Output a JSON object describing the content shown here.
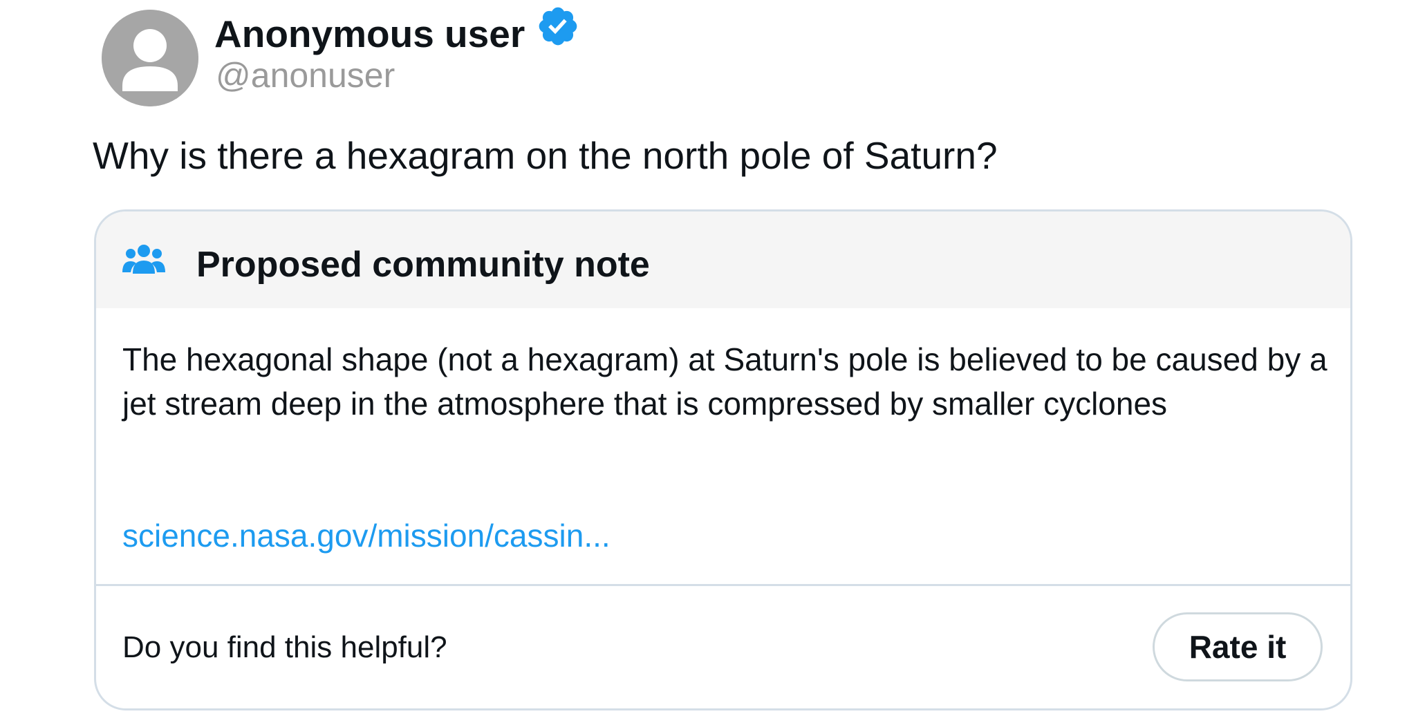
{
  "post": {
    "author": {
      "display_name": "Anonymous user",
      "handle": "@anonuser",
      "verified": true,
      "avatar_icon": "default-person-icon",
      "verified_icon": "verified-badge-icon"
    },
    "text": "Why is there a hexagram on the north pole of Saturn?"
  },
  "community_note": {
    "header_icon": "people-group-icon",
    "title": "Proposed community note",
    "body": "The hexagonal shape (not a hexagram) at Saturn's pole is believed to be caused by a jet stream deep in the atmosphere that is compressed by smaller cyclones",
    "link_text": "science.nasa.gov/mission/cassin...",
    "helpful_prompt": "Do you find this helpful?",
    "rate_button_label": "Rate it"
  },
  "colors": {
    "accent": "#1d9bf0",
    "border": "#d4dee7",
    "header_bg": "#f5f5f5",
    "avatar_bg": "#a6a6a6",
    "handle_text": "#9a9a9a"
  }
}
